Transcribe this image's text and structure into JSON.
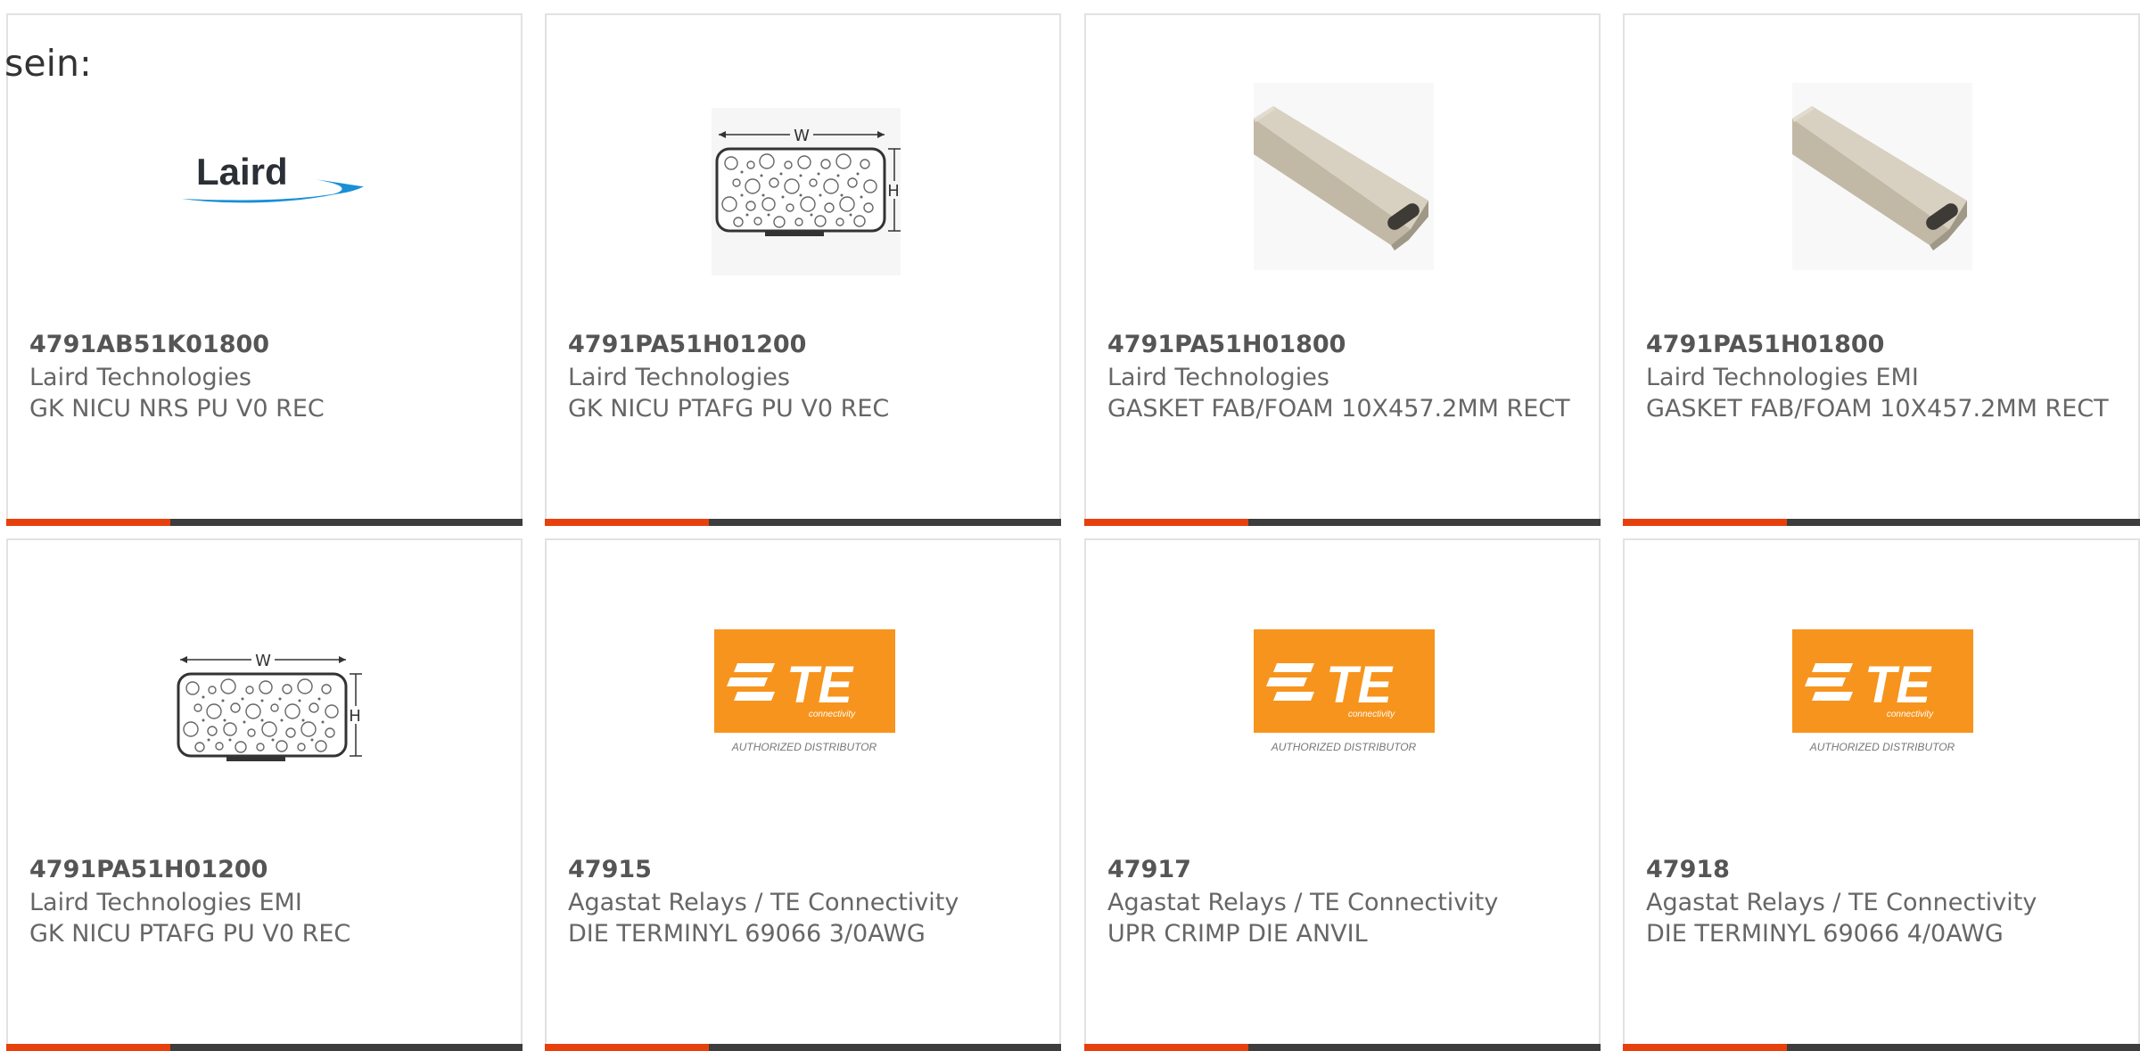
{
  "intro_text": "sein:",
  "colors": {
    "accent": "#e8400c",
    "bar_dark": "#3d3d3d",
    "te_orange": "#f7941d"
  },
  "cards": [
    {
      "image": "laird-logo",
      "part": "4791AB51K01800",
      "manufacturer": "Laird Technologies",
      "description": "GK NICU NRS PU V0 REC",
      "logo_text": "Laird"
    },
    {
      "image": "gasket-diagram",
      "part": "4791PA51H01200",
      "manufacturer": "Laird Technologies",
      "description": "GK NICU PTAFG PU V0 REC",
      "diagram_w": "W",
      "diagram_h": "H"
    },
    {
      "image": "foam-strip",
      "part": "4791PA51H01800",
      "manufacturer": "Laird Technologies",
      "description": "GASKET FAB/FOAM 10X457.2MM RECT"
    },
    {
      "image": "foam-strip",
      "part": "4791PA51H01800",
      "manufacturer": "Laird Technologies EMI",
      "description": "GASKET FAB/FOAM 10X457.2MM RECT"
    },
    {
      "image": "gasket-diagram",
      "part": "4791PA51H01200",
      "manufacturer": "Laird Technologies EMI",
      "description": "GK NICU PTAFG PU V0 REC",
      "diagram_w": "W",
      "diagram_h": "H"
    },
    {
      "image": "te-logo",
      "part": "47915",
      "manufacturer": "Agastat Relays / TE Connectivity",
      "description": "DIE TERMINYL 69066 3/0AWG",
      "logo_text": "TE",
      "logo_sub": "connectivity",
      "logo_caption": "AUTHORIZED DISTRIBUTOR"
    },
    {
      "image": "te-logo",
      "part": "47917",
      "manufacturer": "Agastat Relays / TE Connectivity",
      "description": "UPR CRIMP DIE ANVIL",
      "logo_text": "TE",
      "logo_sub": "connectivity",
      "logo_caption": "AUTHORIZED DISTRIBUTOR"
    },
    {
      "image": "te-logo",
      "part": "47918",
      "manufacturer": "Agastat Relays / TE Connectivity",
      "description": "DIE TERMINYL 69066 4/0AWG",
      "logo_text": "TE",
      "logo_sub": "connectivity",
      "logo_caption": "AUTHORIZED DISTRIBUTOR"
    }
  ]
}
